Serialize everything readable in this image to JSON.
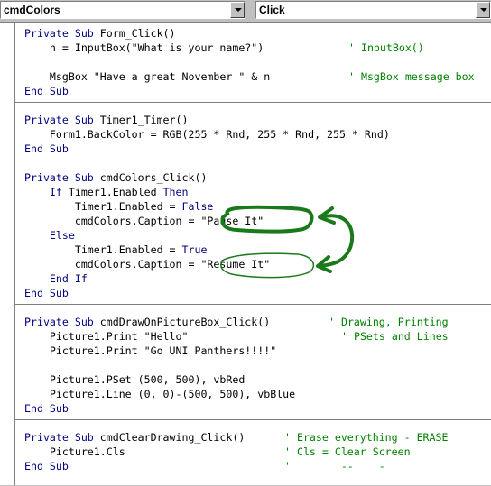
{
  "toolbar": {
    "object_combo": "cmdColors",
    "proc_combo": "Click"
  },
  "code": {
    "p1": {
      "l1_kw": "Private Sub",
      "l1_tx": " Form_Click()",
      "l2_tx": "    n = InputBox(\"What is your name?\")",
      "l2_cm": "' InputBox()",
      "l3_tx": "    MsgBox \"Have a great November \" & n",
      "l3_cm": "' MsgBox message box",
      "l4_kw": "End Sub"
    },
    "p2": {
      "l1_kw": "Private Sub",
      "l1_tx": " Timer1_Timer()",
      "l2_tx": "    Form1.BackColor = RGB(255 * Rnd, 255 * Rnd, 255 * Rnd)",
      "l3_kw": "End Sub"
    },
    "p3": {
      "l1_kw": "Private Sub",
      "l1_tx": " cmdColors_Click()",
      "l2_kw1": "    If",
      "l2_tx": " Timer1.Enabled ",
      "l2_kw2": "Then",
      "l3_tx": "        Timer1.Enabled = ",
      "l3_kw": "False",
      "l4_tx": "        cmdColors.Caption = \"Pause It\"",
      "l5_kw": "    Else",
      "l6_tx": "        Timer1.Enabled = ",
      "l6_kw": "True",
      "l7_tx": "        cmdColors.Caption = \"Resume It\"",
      "l8_kw": "    End If",
      "l9_kw": "End Sub"
    },
    "p4": {
      "l1_kw": "Private Sub",
      "l1_tx": " cmdDrawOnPictureBox_Click()",
      "l1_cm": "' Drawing, Printing",
      "l2_tx": "    Picture1.Print \"Hello\"",
      "l2_cm": "' PSets and Lines",
      "l3_tx": "    Picture1.Print \"Go UNI Panthers!!!!\"",
      "l4_tx": "    Picture1.PSet (500, 500), vbRed",
      "l5_tx": "    Picture1.Line (0, 0)-(500, 500), vbBlue",
      "l6_kw": "End Sub"
    },
    "p5": {
      "l1_kw": "Private Sub",
      "l1_tx": " cmdClearDrawing_Click()",
      "l1_cm": "' Erase everything - ERASE",
      "l2_tx": "    Picture1.Cls",
      "l2_cm": "' Cls = Clear Screen",
      "l3_kw": "End Sub",
      "l3_cm": "'        --    -"
    }
  },
  "colors": {
    "keyword": "#000080",
    "comment": "#008000",
    "annotation": "#1a7a1a"
  }
}
